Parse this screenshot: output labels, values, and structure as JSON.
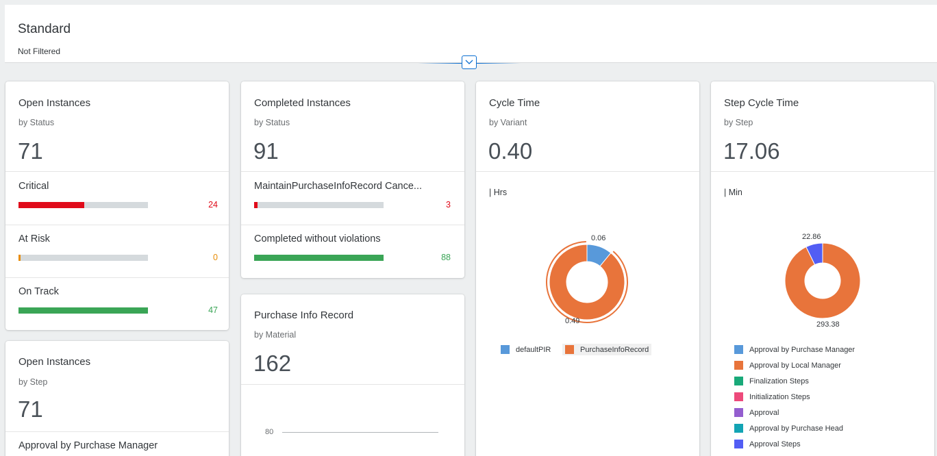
{
  "header": {
    "title": "Standard",
    "subtitle": "Not Filtered"
  },
  "cards": {
    "open_status": {
      "title": "Open Instances",
      "subtitle": "by Status",
      "kpi": "71",
      "rows": [
        {
          "label": "Critical",
          "value": "24",
          "fraction": 0.51,
          "color": "#e00b1a"
        },
        {
          "label": "At Risk",
          "value": "0",
          "fraction": 0.015,
          "color": "#e78c07"
        },
        {
          "label": "On Track",
          "value": "47",
          "fraction": 1.0,
          "color": "#3aa556"
        }
      ]
    },
    "open_step": {
      "title": "Open Instances",
      "subtitle": "by Step",
      "kpi": "71",
      "rows": [
        {
          "label": "Approval by Purchase Manager"
        }
      ]
    },
    "completed": {
      "title": "Completed Instances",
      "subtitle": "by Status",
      "kpi": "91",
      "rows": [
        {
          "label": "MaintainPurchaseInfoRecord Cance...",
          "value": "3",
          "fraction": 0.025,
          "color": "#e00b1a"
        },
        {
          "label": "Completed without violations",
          "value": "88",
          "fraction": 1.0,
          "color": "#3aa556"
        }
      ]
    },
    "pir": {
      "title": "Purchase Info Record",
      "subtitle": "by Material",
      "kpi": "162",
      "axis_tick": "80"
    },
    "cycle": {
      "title": "Cycle Time",
      "subtitle": "by Variant",
      "kpi": "0.40",
      "unit": "| Hrs",
      "chart_data": {
        "type": "pie",
        "slices": [
          {
            "name": "defaultPIR",
            "value": 0.06,
            "color": "#5899da"
          },
          {
            "name": "PurchaseInfoRecord",
            "value": 0.49,
            "color": "#e8743b"
          }
        ],
        "labels": [
          "0.06",
          "0.49"
        ]
      }
    },
    "step_cycle": {
      "title": "Step Cycle Time",
      "subtitle": "by Step",
      "kpi": "17.06",
      "unit": "| Min",
      "chart_data": {
        "type": "pie",
        "slices": [
          {
            "name": "Approval by Purchase Manager",
            "value": 0,
            "color": "#5899da"
          },
          {
            "name": "Approval by Local Manager",
            "value": 293.38,
            "color": "#e8743b"
          },
          {
            "name": "Finalization Steps",
            "value": 0,
            "color": "#19a979"
          },
          {
            "name": "Initialization Steps",
            "value": 0,
            "color": "#ed4a7b"
          },
          {
            "name": "Approval",
            "value": 0,
            "color": "#945ecf"
          },
          {
            "name": "Approval by Purchase Head",
            "value": 0,
            "color": "#13a4b4"
          },
          {
            "name": "Approval Steps",
            "value": 22.86,
            "color": "#525df4"
          }
        ],
        "labels": [
          "22.86",
          "293.38"
        ]
      }
    }
  }
}
